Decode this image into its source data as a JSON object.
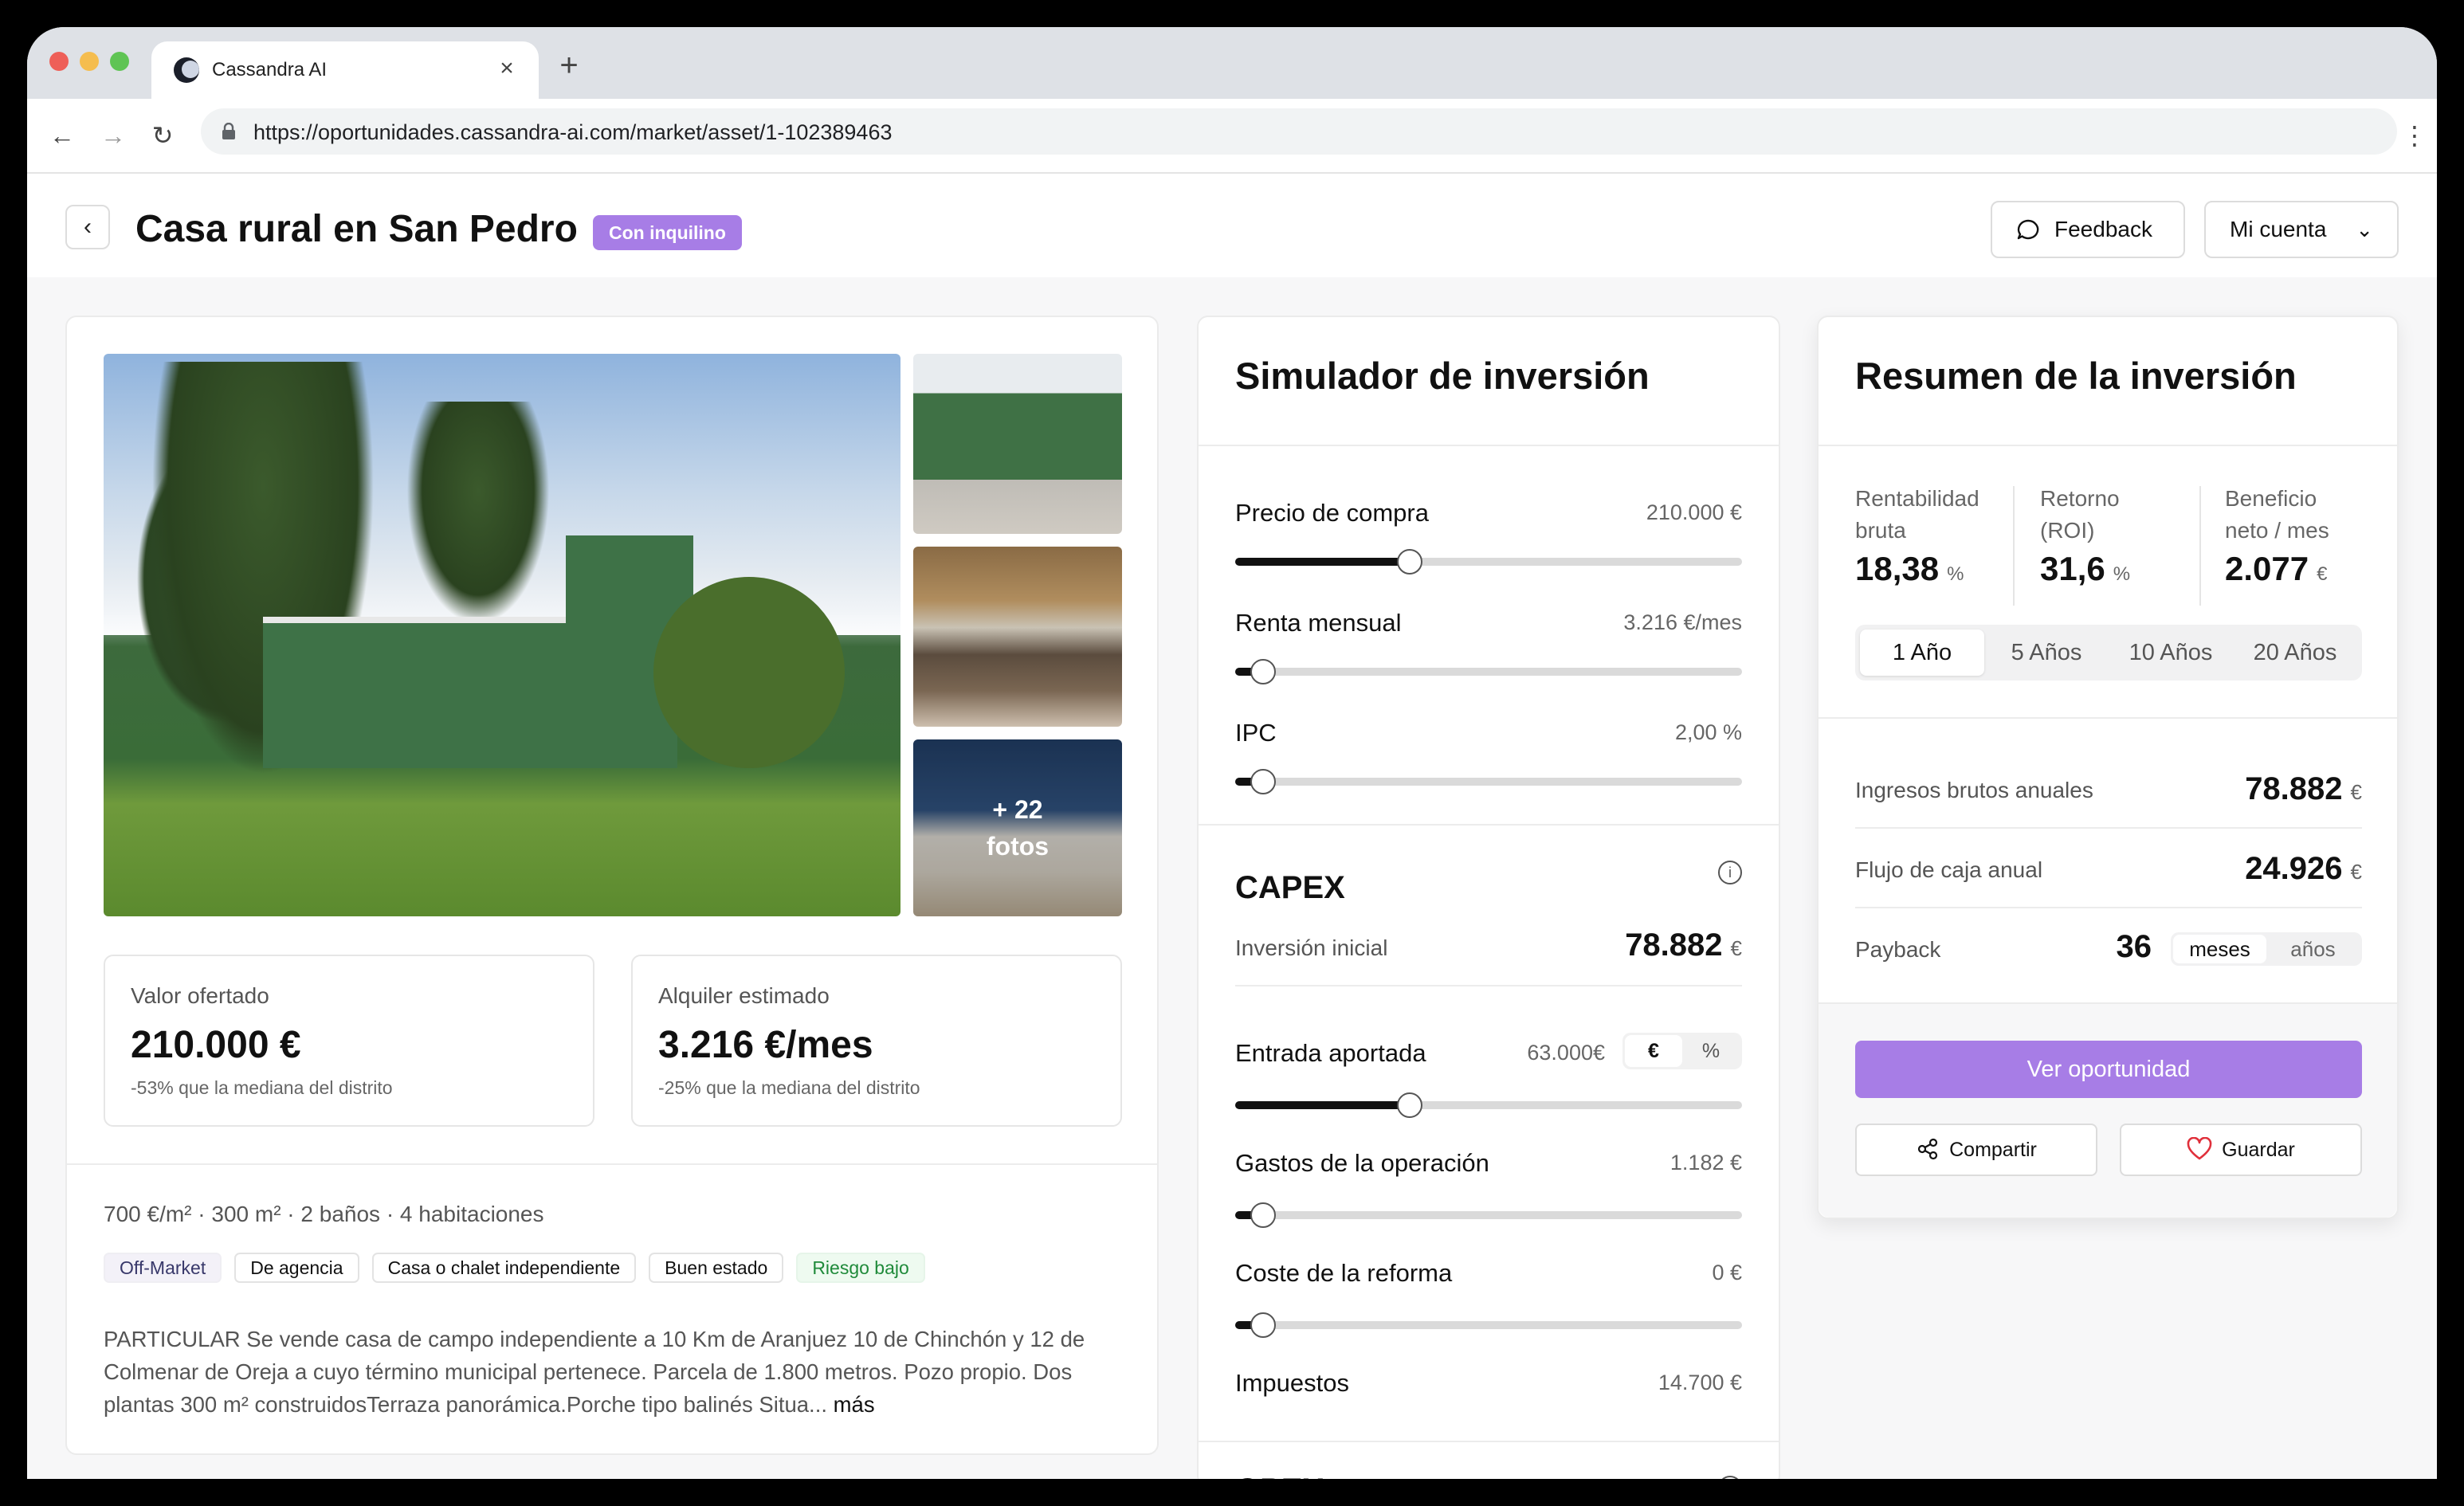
{
  "browser": {
    "tab_title": "Cassandra AI",
    "url": "https://oportunidades.cassandra-ai.com/market/asset/1-102389463"
  },
  "header": {
    "title": "Casa rural en San Pedro",
    "badge": "Con inquilino",
    "feedback_label": "Feedback",
    "account_label": "Mi cuenta",
    "accent_color": "#a77de6"
  },
  "listing": {
    "photos_more_count": "+ 22",
    "photos_more_label": "fotos",
    "offered": {
      "label": "Valor ofertado",
      "value": "210.000 €",
      "note": "-53% que la mediana del distrito"
    },
    "rent": {
      "label": "Alquiler estimado",
      "value": "3.216 €/mes",
      "note": "-25% que la mediana del distrito"
    },
    "specs": "700 €/m² · 300 m² · 2 baños · 4 habitaciones",
    "tags": [
      "Off-Market",
      "De agencia",
      "Casa o chalet independiente",
      "Buen estado",
      "Riesgo bajo"
    ],
    "description": "PARTICULAR Se vende casa de campo independiente a 10 Km de Aranjuez 10 de Chinchón y 12 de Colmenar de Oreja a cuyo término municipal pertenece. Parcela de 1.800 metros. Pozo propio. Dos plantas 300 m² construidosTerraza panorámica.Porche tipo balinés Situa...",
    "more_label": "más"
  },
  "simulator": {
    "title": "Simulador de inversión",
    "price": {
      "label": "Precio de compra",
      "value": "210.000 €",
      "level": 0.345
    },
    "rent": {
      "label": "Renta mensual",
      "value": "3.216 €/mes",
      "level": 0.055
    },
    "ipc": {
      "label": "IPC",
      "value": "2,00 %",
      "level": 0.055
    },
    "capex": {
      "title": "CAPEX",
      "info_icon": "info-icon",
      "initial_label": "Inversión inicial",
      "initial_value": "78.882",
      "initial_unit": "€",
      "entry": {
        "label": "Entrada aportada",
        "value": "63.000€",
        "level": 0.345,
        "toggle": [
          "€",
          "%"
        ],
        "active": "€"
      },
      "ops": {
        "label": "Gastos de la operación",
        "value": "1.182 €",
        "level": 0.055
      },
      "reform": {
        "label": "Coste de la reforma",
        "value": "0 €",
        "level": 0.055
      },
      "taxes": {
        "label": "Impuestos",
        "value": "14.700 €"
      }
    },
    "opex_title": "OPEX"
  },
  "summary": {
    "title": "Resumen de la inversión",
    "kpis": [
      {
        "label_1": "Rentabilidad",
        "label_2": "bruta",
        "value": "18,38",
        "unit": "%"
      },
      {
        "label_1": "Retorno",
        "label_2": "(ROI)",
        "value": "31,6",
        "unit": "%"
      },
      {
        "label_1": "Beneficio",
        "label_2": "neto / mes",
        "value": "2.077",
        "unit": "€"
      }
    ],
    "periods": [
      "1 Año",
      "5 Años",
      "10 Años",
      "20 Años"
    ],
    "active_period": "1 Año",
    "gross_income": {
      "label": "Ingresos brutos anuales",
      "value": "78.882",
      "unit": "€"
    },
    "cash_flow": {
      "label": "Flujo de caja anual",
      "value": "24.926",
      "unit": "€"
    },
    "payback": {
      "label": "Payback",
      "value": "36",
      "toggle": [
        "meses",
        "años"
      ],
      "active": "meses"
    },
    "cta_label": "Ver oportunidad",
    "share_label": "Compartir",
    "save_label": "Guardar"
  }
}
